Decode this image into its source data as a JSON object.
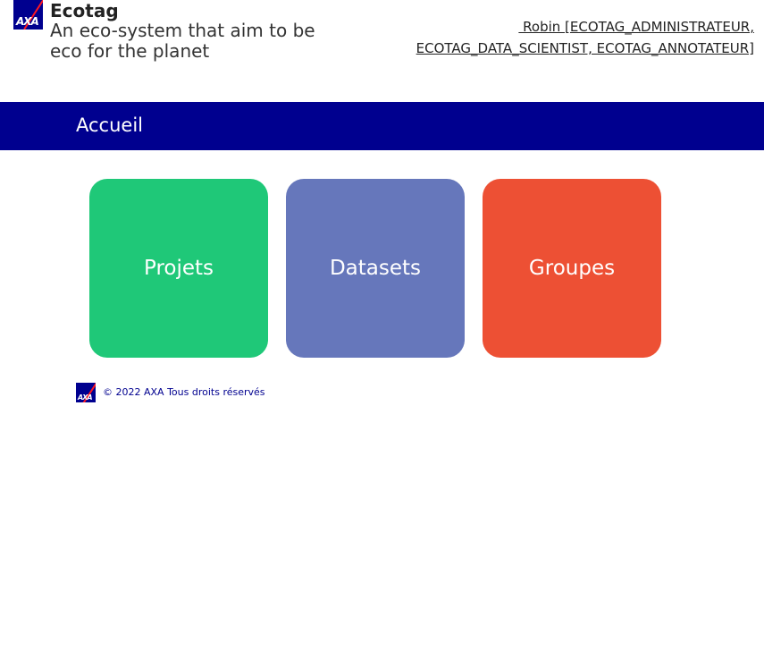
{
  "header": {
    "logo_text": "AXA",
    "app_name": "Ecotag",
    "tagline_line1": "An eco-system that aim to be",
    "tagline_line2": "eco for the planet",
    "user_line1": " Robin [ECOTAG_ADMINISTRATEUR,",
    "user_line2": "ECOTAG_DATA_SCIENTIST, ECOTAG_ANNOTATEUR]"
  },
  "nav": {
    "home": "Accueil"
  },
  "tiles": [
    {
      "label": "Projets",
      "color": "#1fc878"
    },
    {
      "label": "Datasets",
      "color": "#6677bb"
    },
    {
      "label": "Groupes",
      "color": "#ed5034"
    }
  ],
  "footer": {
    "logo_text": "AXA",
    "copyright": "© 2022 AXA Tous droits réservés"
  },
  "colors": {
    "navbar": "#00008f",
    "logo_red": "#ff1721"
  }
}
